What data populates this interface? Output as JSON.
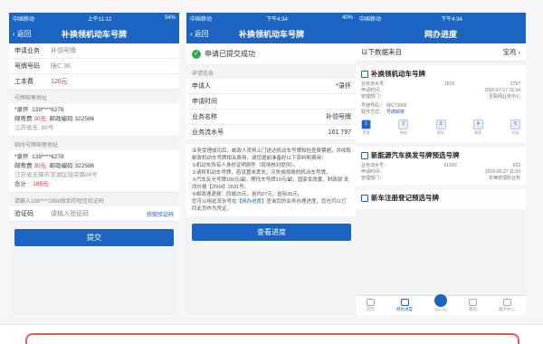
{
  "phone1": {
    "status_left": "中国移动",
    "status_time": "上午11:12",
    "status_right": "54%",
    "back_label": "返回",
    "title": "补换领机动车号牌",
    "rows": [
      {
        "label": "申请业务",
        "value": "补领号牌"
      },
      {
        "label": "号牌号码",
        "value": "陕C    36"
      },
      {
        "label": "工本费",
        "value": "120元"
      }
    ],
    "mail_caption": "号牌邮寄地址",
    "mail_name": "*录怀",
    "mail_phone": "139****6278",
    "mail_fee_label": "邮寄费",
    "mail_fee": "30元",
    "mail_zip_label": "邮政编码",
    "mail_zip": "322586",
    "mail_addr": "江苏省无        ,88号",
    "temp_caption": "临时号牌邮寄地址",
    "temp_name": "*录怀",
    "temp_phone": "139****6278",
    "temp_fee_label": "邮寄费",
    "temp_fee": "30元",
    "temp_zip_label": "邮政编码",
    "temp_zip": "322586",
    "temp_addr": "江苏省无锡市滨湖区钱荣路88号",
    "total_label": "合计",
    "total": "185元",
    "sms_hint": "请输入188****2958收到的短信验证码",
    "code_label": "验证码",
    "code_placeholder": "请输入验证码",
    "get_code": "获取验证码",
    "submit": "提交"
  },
  "phone2": {
    "status_left": "中国移动",
    "status_time": "下午4:34",
    "status_right": "40%",
    "back_label": "返回",
    "title": "补换领机动车号牌",
    "success_text": "申请已提交成功",
    "info_caption": "申请信息",
    "rows": [
      {
        "label": "申请人",
        "value": "*录怀"
      },
      {
        "label": "申请时间",
        "value": ""
      },
      {
        "label": "业务名称",
        "value": "补领号牌"
      },
      {
        "label": "业务流水号",
        "value": "161            797"
      }
    ],
    "notice_1": "业务受理成功后，邮政人员将上门送达机动车号牌和检查费票据，并收取邮政机动车号牌相关费用，请您提前准备好以下资料和费用：",
    "notice_2": "①机动车所有人身份证明原件（现场核对提供）。",
    "notice_3": "②请将机动车号牌，若设置未丢失，灭失或损毁的机动车号牌。",
    "notice_4": "③汽车反光号牌100元/副，摩托车号牌10元/副，国家发改委、财政部 发改价格【2004】2831号。",
    "notice_5": "④邮政速递费：同城25元，省内27元，省际35元。",
    "notice_6": "您可以用此流水号在",
    "notice_link": "【网办进度】",
    "notice_7": "查询您的业务办理进度，您也可以打印此页作为凭证。",
    "button": "查看进度"
  },
  "phone3": {
    "status_left": "中国移动",
    "status_time": "下午4:34",
    "status_right": "",
    "title": "网办进度",
    "data_source_label": "以下数据来自",
    "data_source": "宝鸡",
    "card1": {
      "title": "补换领机动车号牌",
      "serial_label": "业务流水号：",
      "serial_a": "1610",
      "serial_b": "2797",
      "time_label": "申请时间：",
      "time": "2016-07-17 16:34",
      "org_label": "管理部门：",
      "org": "互联网业务中心",
      "plate_label": "号牌号码：",
      "plate": "陕C73666",
      "method_label": "取件方式：",
      "method": "号牌邮寄",
      "steps": [
        "1",
        "2",
        "3",
        "4",
        "5"
      ],
      "step_labels": [
        "受理",
        "审核",
        "制证",
        "邮寄",
        "完成"
      ]
    },
    "card2": {
      "title": "新能源汽车换发号牌预选号牌",
      "serial_label": "业务流水号：",
      "serial_a": "6103C",
      "serial_b": "633",
      "time_label": "申请时间：",
      "time": "2016-06-27 11:09",
      "org_label": "管理部门：",
      "org": "车辆管理所业务"
    },
    "card3": {
      "title": "新车注册登记预选号牌"
    },
    "tabs": [
      "首页",
      "网办进度",
      "扫一扫",
      "我的",
      "服务中心"
    ]
  },
  "colors": {
    "primary": "#1c64c4",
    "accent_red": "#e4393c",
    "success": "#33a854"
  }
}
